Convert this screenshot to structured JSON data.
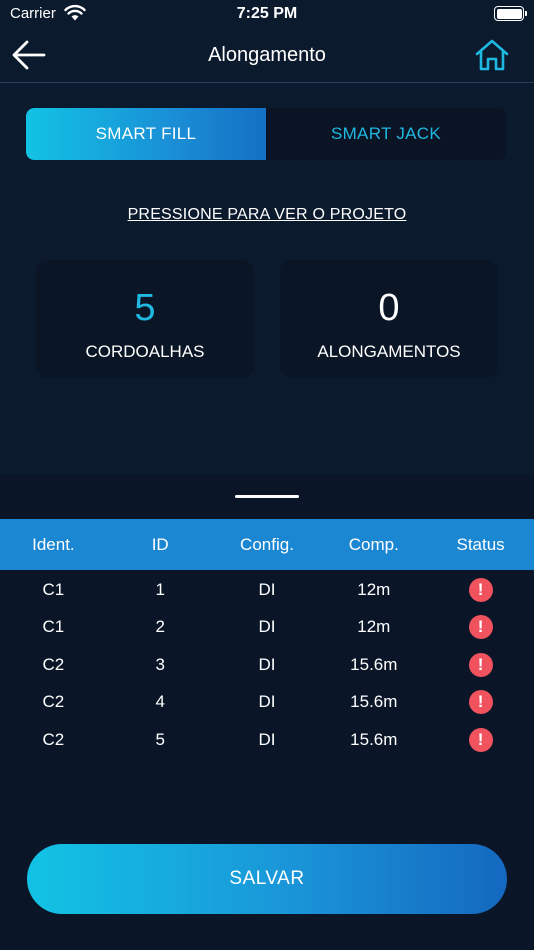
{
  "status_bar": {
    "carrier": "Carrier",
    "time": "7:25 PM"
  },
  "nav": {
    "title": "Alongamento",
    "back_icon": "arrow-left-icon",
    "home_icon": "home-icon"
  },
  "tabs": [
    {
      "label": "SMART FILL",
      "active": true
    },
    {
      "label": "SMART JACK",
      "active": false
    }
  ],
  "project_link": "PRESSIONE PARA VER O PROJETO",
  "stats": [
    {
      "value": "5",
      "label": "CORDOALHAS"
    },
    {
      "value": "0",
      "label": "ALONGAMENTOS"
    }
  ],
  "table": {
    "headers": [
      "Ident.",
      "ID",
      "Config.",
      "Comp.",
      "Status"
    ],
    "rows": [
      {
        "ident": "C1",
        "id": "1",
        "config": "DI",
        "comp": "12m",
        "status": "!"
      },
      {
        "ident": "C1",
        "id": "2",
        "config": "DI",
        "comp": "12m",
        "status": "!"
      },
      {
        "ident": "C2",
        "id": "3",
        "config": "DI",
        "comp": "15.6m",
        "status": "!"
      },
      {
        "ident": "C2",
        "id": "4",
        "config": "DI",
        "comp": "15.6m",
        "status": "!"
      },
      {
        "ident": "C2",
        "id": "5",
        "config": "DI",
        "comp": "15.6m",
        "status": "!"
      }
    ]
  },
  "save_label": "SALVAR",
  "colors": {
    "background": "#0c1a2e",
    "accent": "#1fb8e0",
    "header": "#1b86d2",
    "alert": "#f0525e"
  }
}
